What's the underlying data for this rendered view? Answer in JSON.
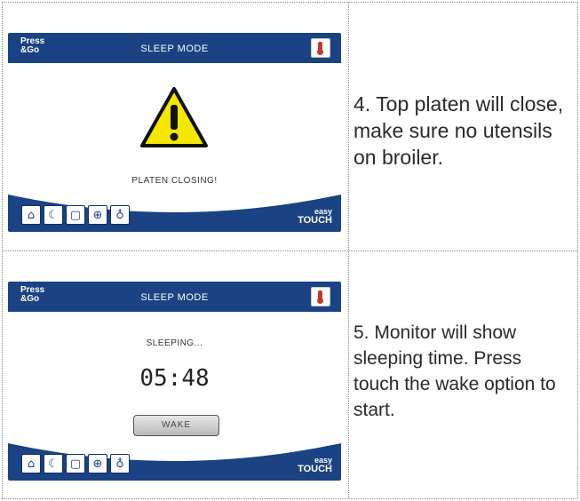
{
  "rows": [
    {
      "screen": {
        "logo": "Press &Go",
        "title": "SLEEP MODE",
        "message": "PLATEN CLOSING!",
        "brand_top": "easy",
        "brand_bottom": "TOUCH"
      },
      "instruction": "4.  Top platen will close, make sure no utensils on broiler."
    },
    {
      "screen": {
        "logo": "Press &Go",
        "title": "SLEEP MODE",
        "message": "SLEEPING...",
        "timer": "05:48",
        "wake_label": "WAKE",
        "brand_top": "easy",
        "brand_bottom": "TOUCH"
      },
      "instruction": "5.  Monitor will show sleeping time. Press touch the wake option to start."
    }
  ],
  "toolbar_icons": [
    "home-icon",
    "moon-icon",
    "lock-icon",
    "globe-icon",
    "lightbulb-icon"
  ],
  "colors": {
    "panel_blue": "#1b4283",
    "warning_yellow": "#f3e600"
  }
}
